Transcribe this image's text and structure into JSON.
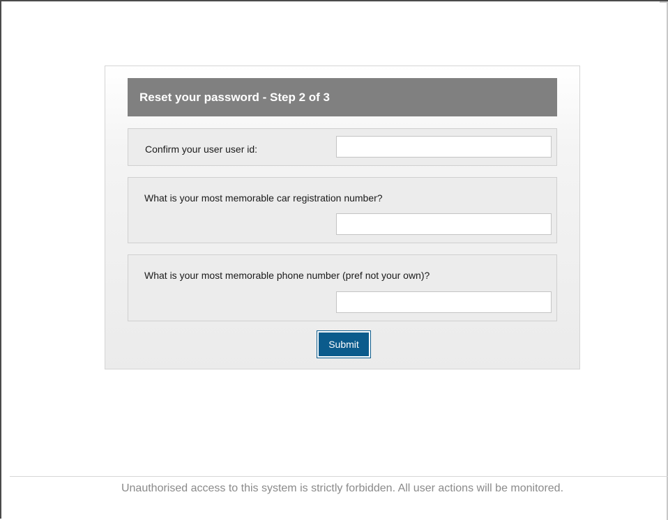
{
  "form": {
    "title": "Reset your password - Step 2 of 3",
    "fields": [
      {
        "label": "Confirm your user user id:",
        "value": "",
        "placeholder": ""
      },
      {
        "label": "What is your most memorable car registration number?",
        "value": "",
        "placeholder": ""
      },
      {
        "label": "What is your most memorable phone number (pref not your own)?",
        "value": "",
        "placeholder": ""
      }
    ],
    "submit_label": "Submit"
  },
  "footer": {
    "notice": "Unauthorised access to this system is strictly forbidden. All user actions will be monitored."
  },
  "colors": {
    "header_bg": "#808080",
    "button_bg": "#0b5b8c",
    "footer_text": "#8a8a8a"
  }
}
